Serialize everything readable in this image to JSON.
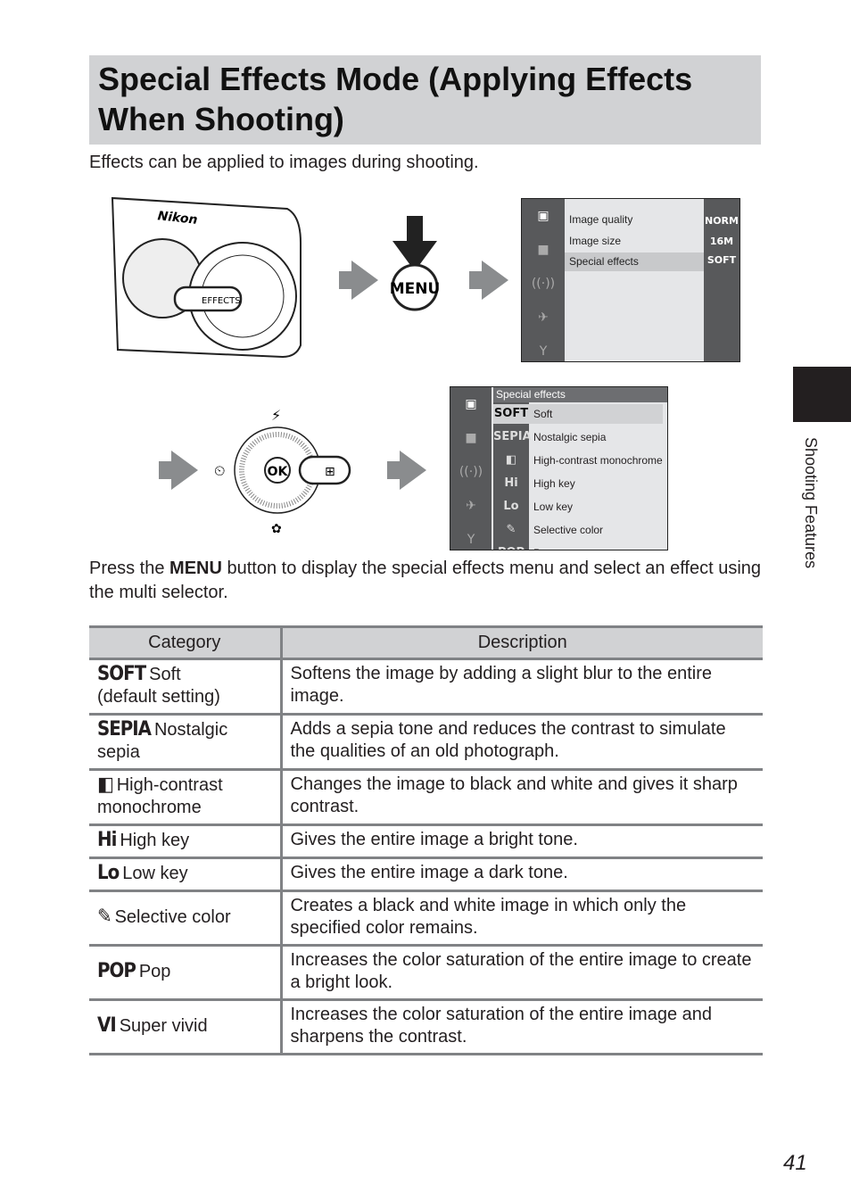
{
  "title": "Special Effects Mode (Applying Effects When Shooting)",
  "intro": "Effects can be applied to images during shooting.",
  "camera": {
    "brand": "Nikon",
    "dial_label": "EFFECTS",
    "menu_button": "MENU",
    "ok_button": "OK"
  },
  "shooting_menu": {
    "items": [
      {
        "label": "Image quality",
        "value": "NORM"
      },
      {
        "label": "Image size",
        "value": "16M"
      },
      {
        "label": "Special effects",
        "value": "SOFT",
        "selected": true
      }
    ]
  },
  "effects_menu": {
    "header": "Special effects",
    "items": [
      {
        "icon": "SOFT",
        "label": "Soft"
      },
      {
        "icon": "SEPIA",
        "label": "Nostalgic sepia"
      },
      {
        "icon": "◧",
        "label": "High-contrast monochrome"
      },
      {
        "icon": "Hi",
        "label": "High key"
      },
      {
        "icon": "Lo",
        "label": "Low key"
      },
      {
        "icon": "✎",
        "label": "Selective color"
      },
      {
        "icon": "POP",
        "label": "Pop"
      }
    ]
  },
  "instruction_prefix": "Press the ",
  "instruction_button": "MENU",
  "instruction_suffix": " button to display the special effects menu and select an effect using the multi selector.",
  "table": {
    "headers": [
      "Category",
      "Description"
    ],
    "rows": [
      {
        "icon": "SOFT",
        "category": "Soft",
        "note": "(default setting)",
        "description": "Softens the image by adding a slight blur to the entire image."
      },
      {
        "icon": "SEPIA",
        "category": "Nostalgic sepia",
        "description": "Adds a sepia tone and reduces the contrast to simulate the qualities of an old photograph."
      },
      {
        "icon": "◧",
        "category": "High-contrast monochrome",
        "description": "Changes the image to black and white and gives it sharp contrast."
      },
      {
        "icon": "Hi",
        "category": "High key",
        "description": "Gives the entire image a bright tone."
      },
      {
        "icon": "Lo",
        "category": "Low key",
        "description": "Gives the entire image a dark tone."
      },
      {
        "icon": "✎",
        "category": "Selective color",
        "description": "Creates a black and white image in which only the specified color remains."
      },
      {
        "icon": "POP",
        "category": "Pop",
        "description": "Increases the color saturation of the entire image to create a bright look."
      },
      {
        "icon": "VI",
        "category": "Super vivid",
        "description": "Increases the color saturation of the entire image and sharpens the contrast."
      }
    ]
  },
  "side_label": "Shooting Features",
  "page_number": "41"
}
